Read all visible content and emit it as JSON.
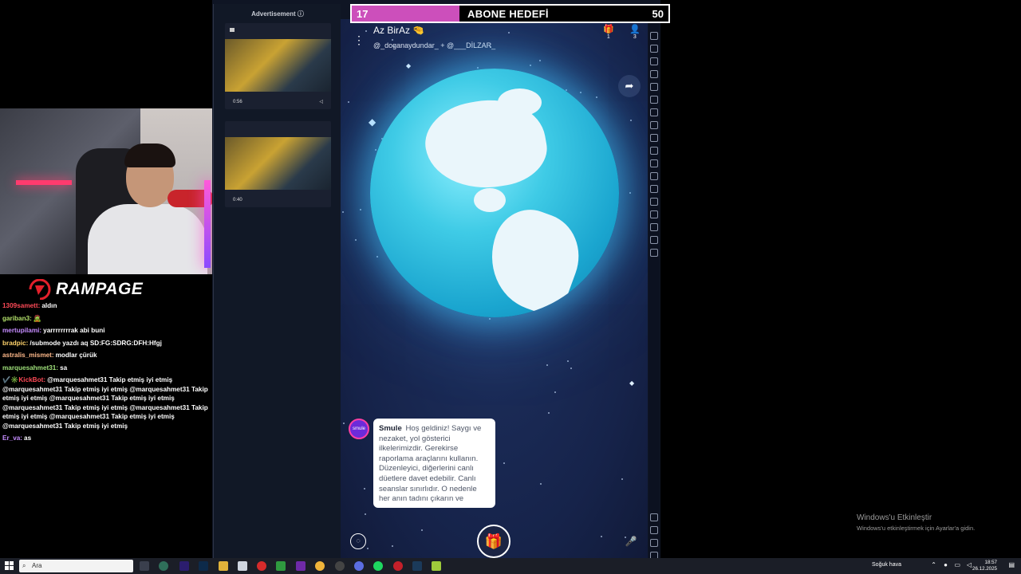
{
  "goal": {
    "current": "17",
    "label": "ABONE HEDEFİ",
    "target": "50",
    "progress_fraction": 0.34
  },
  "brand": {
    "name": "RAMPAGE"
  },
  "chat": {
    "messages": [
      {
        "user": "1309samett:",
        "text": "aldın",
        "color": "#ff4a57"
      },
      {
        "user": "gariban3:",
        "text": "🧟",
        "color": "#b4e26b"
      },
      {
        "user": "mertupilami:",
        "text": "yarrrrrrrrak abi buni",
        "color": "#c58cff"
      },
      {
        "user": "bradpic:",
        "text": "/submode yazdı aq SD:FG:SDRG:DFH:Hfgj",
        "color": "#ffd36b"
      },
      {
        "user": "astralis_mismet:",
        "text": "modlar çürük",
        "color": "#ffb98a"
      },
      {
        "user": "marquesahmet31:",
        "text": "sa",
        "color": "#9fe07a"
      },
      {
        "user": "KickBot:",
        "text": "@marquesahmet31 Takip etmiş iyi etmiş @marquesahmet31 Takip etmiş iyi etmiş @marquesahmet31 Takip etmiş iyi etmiş @marquesahmet31 Takip etmiş iyi etmiş @marquesahmet31 Takip etmiş iyi etmiş @marquesahmet31 Takip etmiş iyi etmiş @marquesahmet31 Takip etmiş iyi etmiş @marquesahmet31 Takip etmiş iyi etmiş",
        "color": "#ff4a57",
        "badges": "✔️✳️"
      },
      {
        "user": "Er_va:",
        "text": "as",
        "color": "#c58cff"
      }
    ]
  },
  "ad": {
    "title": "Advertisement ⓘ",
    "cards": [
      {
        "time": "0:56"
      },
      {
        "time": "0:40"
      }
    ]
  },
  "room": {
    "title": "Az BirAz 🤏",
    "hosts": "@_doganaydundar_ + @___DİLZAR_",
    "gift_count": "1",
    "user_count": "3"
  },
  "welcome": {
    "sender": "Smule",
    "text": "Hoş geldiniz! Saygı ve nezaket, yol gösterici ilkelerimizdir. Gerekirse raporlama araçlarını kullanın. Düzenleyici, diğerlerini canlı düetlere davet edebilir. Canlı seanslar sınırlıdır. O nedenle her anın tadını çıkarın ve",
    "avatar_text": "smule"
  },
  "activate": {
    "line1": "Windows'u Etkinleştir",
    "line2": "Windows'u etkinleştirmek için Ayarlar'a gidin."
  },
  "taskbar": {
    "search_placeholder": "Ara",
    "weather": "Soğuk hava",
    "time": "18:57",
    "date": "26.12.2025"
  },
  "colors": {
    "app_bg": "#1a2a55",
    "goal_fill": "#cc4fbb",
    "globe": "#3fcbe6"
  },
  "icons": [
    "menu-icon",
    "gift-icon",
    "person-icon",
    "share-icon",
    "chat-icon",
    "mic-icon",
    "search-icon",
    "windows-start-icon"
  ]
}
